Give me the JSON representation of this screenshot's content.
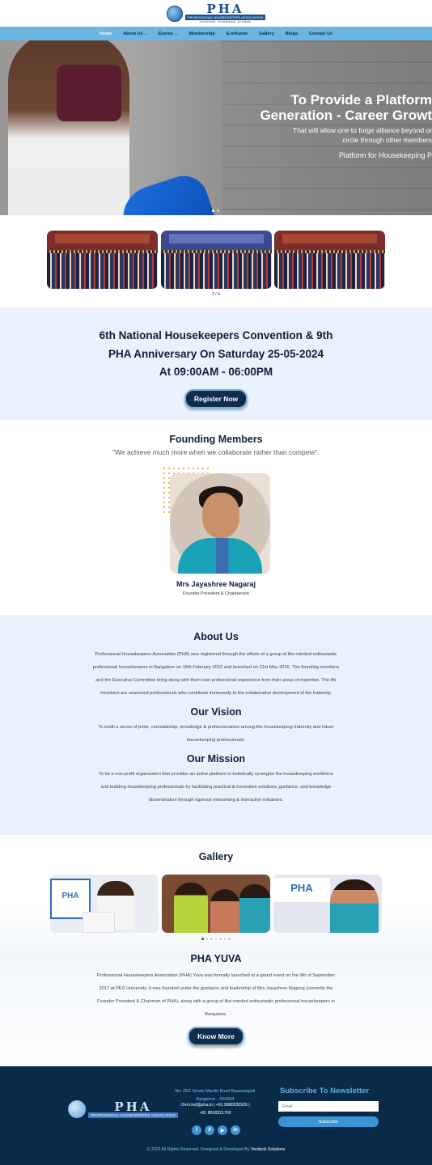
{
  "logo": {
    "name": "PHA",
    "subtitle": "PROFESSIONAL HOUSEKEEPERS ASSOCIATION",
    "tagline": "TO INNOVATE · TO INTEGRATE · TO CREATE"
  },
  "nav": {
    "items": [
      {
        "label": "Home",
        "active": true,
        "dropdown": false
      },
      {
        "label": "About Us",
        "active": false,
        "dropdown": true
      },
      {
        "label": "Events",
        "active": false,
        "dropdown": true
      },
      {
        "label": "Membership",
        "active": false,
        "dropdown": false
      },
      {
        "label": "E-infozine",
        "active": false,
        "dropdown": false
      },
      {
        "label": "Gallery",
        "active": false,
        "dropdown": false
      },
      {
        "label": "Blogs",
        "active": false,
        "dropdown": false
      },
      {
        "label": "Contact Us",
        "active": false,
        "dropdown": false
      }
    ],
    "chevron_icon": "chevron-down-icon"
  },
  "hero": {
    "title_line1": "To Provide a Platform",
    "title_line2": "Generation - Career Growt",
    "sub_line1": "That will allow one to forge alliance beyond or",
    "sub_line2": "circle through other members",
    "sub_line3": "Platform for Housekeeping P"
  },
  "event_carousel": {
    "counter": "2 / 4"
  },
  "convention": {
    "line1": "6th National Housekeepers Convention & 9th",
    "line2": "PHA Anniversary  On Saturday 25-05-2024",
    "line3": "At 09:00AM - 06:00PM",
    "button": "Register Now"
  },
  "founding": {
    "title": "Founding Members",
    "quote": "\"We achieve much more when we collaborate rather than compete\".",
    "name": "Mrs Jayashree Nagaraj",
    "role": "Founder President & Chairperson"
  },
  "about": {
    "title": "About Us",
    "text_lines": [
      "Professional Housekeepers Association (PHA) was registered through the efforts of a group of  like-minded enthusiastic",
      "professional housekeepers in Bangalore on 16th February 2015 and launched on 21st May 2015. The founding members",
      "and the Executive Committee bring along with them vast professional experience from their areas of expertise. The life",
      "members are seasoned professionals who contribute immensely to the collaborative development of the fraternity."
    ],
    "vision_title": "Our Vision",
    "vision_lines": [
      "To instill a sense of pride, comradeship, knowledge & professionalism among the housekeeping fraternity and future",
      "housekeeping professionals."
    ],
    "mission_title": "Our Mission",
    "mission_lines": [
      "To be a non-profit organization that provides an active platform to holistically synergize the housekeeping workforce",
      "and budding housekeeping professionals by facilitating practical  & innovative solutions, guidance, and knowledge",
      "dissemination through rigorous  networking & interactive initiatives."
    ]
  },
  "gallery": {
    "title": "Gallery",
    "board_text_1": "PHA",
    "board_text_2": "PHA"
  },
  "yuva": {
    "title": "PHA YUVA",
    "text_lines": [
      "Professional Housekeepers Association (PHA) Yuva was formally launched at a grand event on the 9th of September",
      "2017 at PES University. It was founded under the guidance and leadership of Mrs.Jayashree Nagaraj (currently the",
      "Founder President & Chairman of PHA), along with a group of like-minded enthusiastic professional housekeepers in",
      "Bangalore."
    ],
    "button": "Know More"
  },
  "footer": {
    "logo_name": "PHA",
    "logo_sub": "PROFESSIONAL HOUSEKEEPERS ASSOCIATION",
    "address_line1": "No: 25/1 Sriram Mandir Road Basavangudi",
    "address_line2": "Bangalore – 560004",
    "contact_line1": "chrm.ind@pha.in  |  +91 9880030926  |",
    "contact_line2": "+91 8618321769",
    "socials": [
      {
        "icon": "facebook-icon",
        "glyph": "f"
      },
      {
        "icon": "x-icon",
        "glyph": "X"
      },
      {
        "icon": "youtube-icon",
        "glyph": "▶"
      },
      {
        "icon": "linkedin-icon",
        "glyph": "in"
      }
    ],
    "newsletter_title": "Subscribe To Newsletter",
    "email_placeholder": "Email",
    "subscribe_button": "Subscribe",
    "copyright": "© 2023 All Rights Reserved. Designed & Developed By",
    "developer": "Veniteck Solutions"
  },
  "colors": {
    "nav_bg": "#6ab6e0",
    "section_bg": "#e8f1fc",
    "dark_navy": "#0e2d4f",
    "footer_bg": "#0a2a4a",
    "accent_blue": "#3d94d4"
  }
}
